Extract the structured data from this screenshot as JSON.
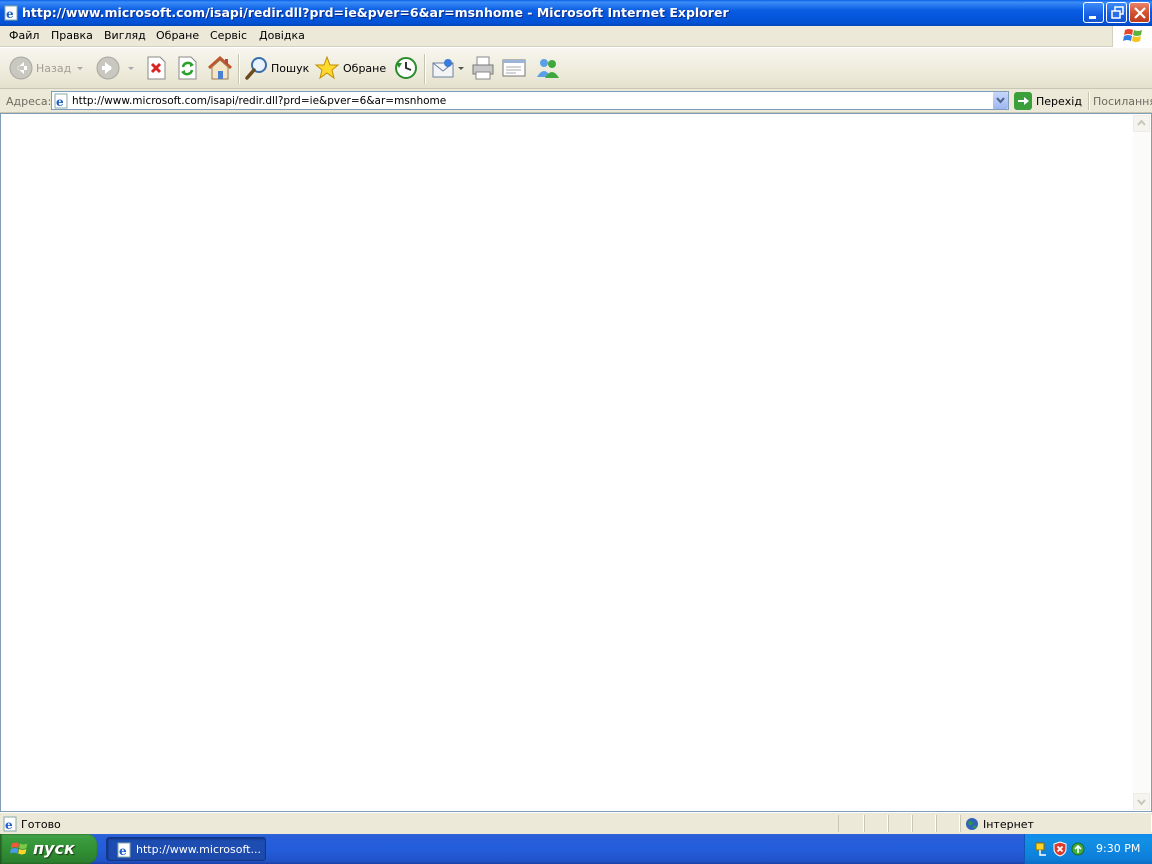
{
  "window": {
    "title": "http://www.microsoft.com/isapi/redir.dll?prd=ie&pver=6&ar=msnhome - Microsoft Internet Explorer"
  },
  "menu": {
    "items": [
      "Файл",
      "Правка",
      "Вигляд",
      "Обране",
      "Сервіс",
      "Довідка"
    ]
  },
  "toolbar": {
    "back_label": "Назад",
    "search_label": "Пошук",
    "favorites_label": "Обране"
  },
  "address": {
    "label": "Адреса:",
    "url": "http://www.microsoft.com/isapi/redir.dll?prd=ie&pver=6&ar=msnhome",
    "go_label": "Перехід",
    "links_label": "Посилання"
  },
  "status": {
    "text": "Готово",
    "zone": "Інтернет"
  },
  "taskbar": {
    "start_label": "пуск",
    "task_label": "http://www.microsoft...",
    "clock": "9:30 PM"
  },
  "colors": {
    "titlebar": "#0A5CE3",
    "chrome": "#ECE9D8",
    "taskbar": "#245DDB",
    "start": "#3A9B3F",
    "tray": "#0D7FDA"
  }
}
